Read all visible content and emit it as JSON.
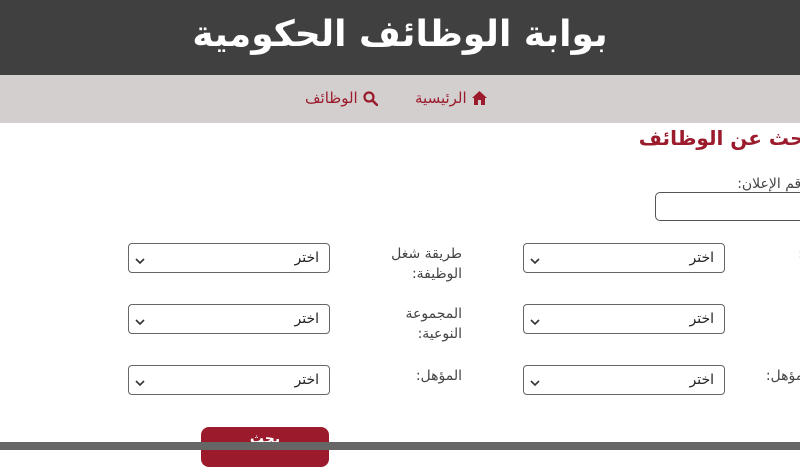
{
  "header": {
    "title": "بوابة الوظائف الحكومية"
  },
  "nav": {
    "home": {
      "label": "الرئيسية",
      "icon": "home-icon"
    },
    "jobs": {
      "label": "الوظائف",
      "icon": "search-icon"
    }
  },
  "page": {
    "title": "بحث عن الوظائف"
  },
  "filters": {
    "announcement_number_label": "رقم الإعلان:",
    "job_method_label": "طريقة شغل\nالوظيفة:",
    "qualitative_group_label": "المجموعة\nالنوعية:",
    "qualification_label": "المؤهل:",
    "qualification_right_label": "المؤهل:",
    "right_row1_label": ":",
    "select_default": "اختر"
  },
  "actions": {
    "search_label": "بحث"
  },
  "colors": {
    "accent": "#9b1b2c",
    "header_bg": "#404040",
    "nav_bg": "#d4cfcf"
  }
}
